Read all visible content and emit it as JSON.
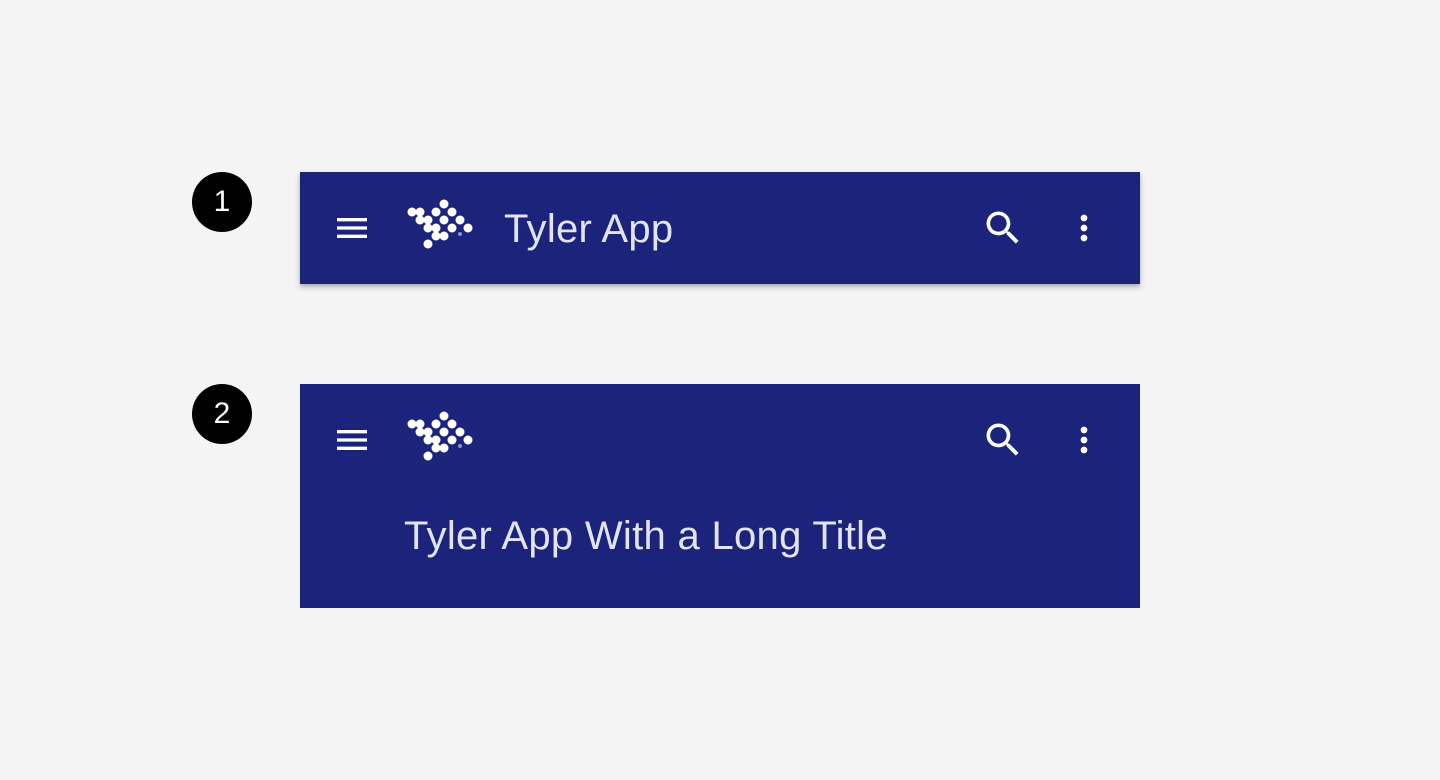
{
  "markers": [
    "1",
    "2"
  ],
  "colors": {
    "page_background": "#f4f4f4",
    "appbar_background": "#1b237b",
    "title_text": "#e2e3f3",
    "icon": "#ffffff",
    "marker_background": "#000000",
    "marker_text": "#ffffff"
  },
  "appbar_standard": {
    "title": "Tyler App",
    "icons": [
      "menu-icon",
      "tyler-logo-icon",
      "search-icon",
      "more-vert-icon"
    ]
  },
  "appbar_extended": {
    "title": "Tyler App With a Long Title",
    "icons": [
      "menu-icon",
      "tyler-logo-icon",
      "search-icon",
      "more-vert-icon"
    ]
  }
}
